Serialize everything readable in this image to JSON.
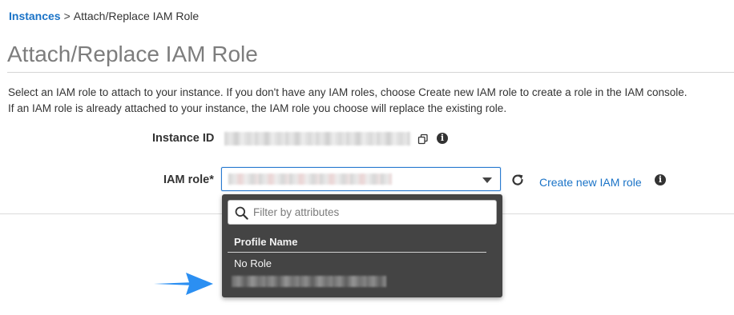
{
  "breadcrumb": {
    "link": "Instances",
    "separator": ">",
    "current": "Attach/Replace IAM Role"
  },
  "page": {
    "title": "Attach/Replace IAM Role",
    "description_line1": "Select an IAM role to attach to your instance. If you don't have any IAM roles, choose Create new IAM role to create a role in the IAM console.",
    "description_line2": "If an IAM role is already attached to your instance, the IAM role you choose will replace the existing role."
  },
  "form": {
    "instance_id_label": "Instance ID",
    "iam_role_label": "IAM role*",
    "create_role_link": "Create new IAM role",
    "info_glyph": "i"
  },
  "dropdown": {
    "filter_placeholder": "Filter by attributes",
    "column_header": "Profile Name",
    "items": [
      "No Role"
    ]
  },
  "icons": {
    "copy": "copy-icon",
    "info": "info-icon",
    "refresh": "refresh-icon",
    "search": "search-icon",
    "caret": "chevron-down-icon",
    "arrow": "arrow-right-icon"
  },
  "colors": {
    "link": "#1a73c7",
    "arrow": "#2b8ff2",
    "dropdown_bg": "#444444",
    "select_border": "#2a7bd0"
  }
}
